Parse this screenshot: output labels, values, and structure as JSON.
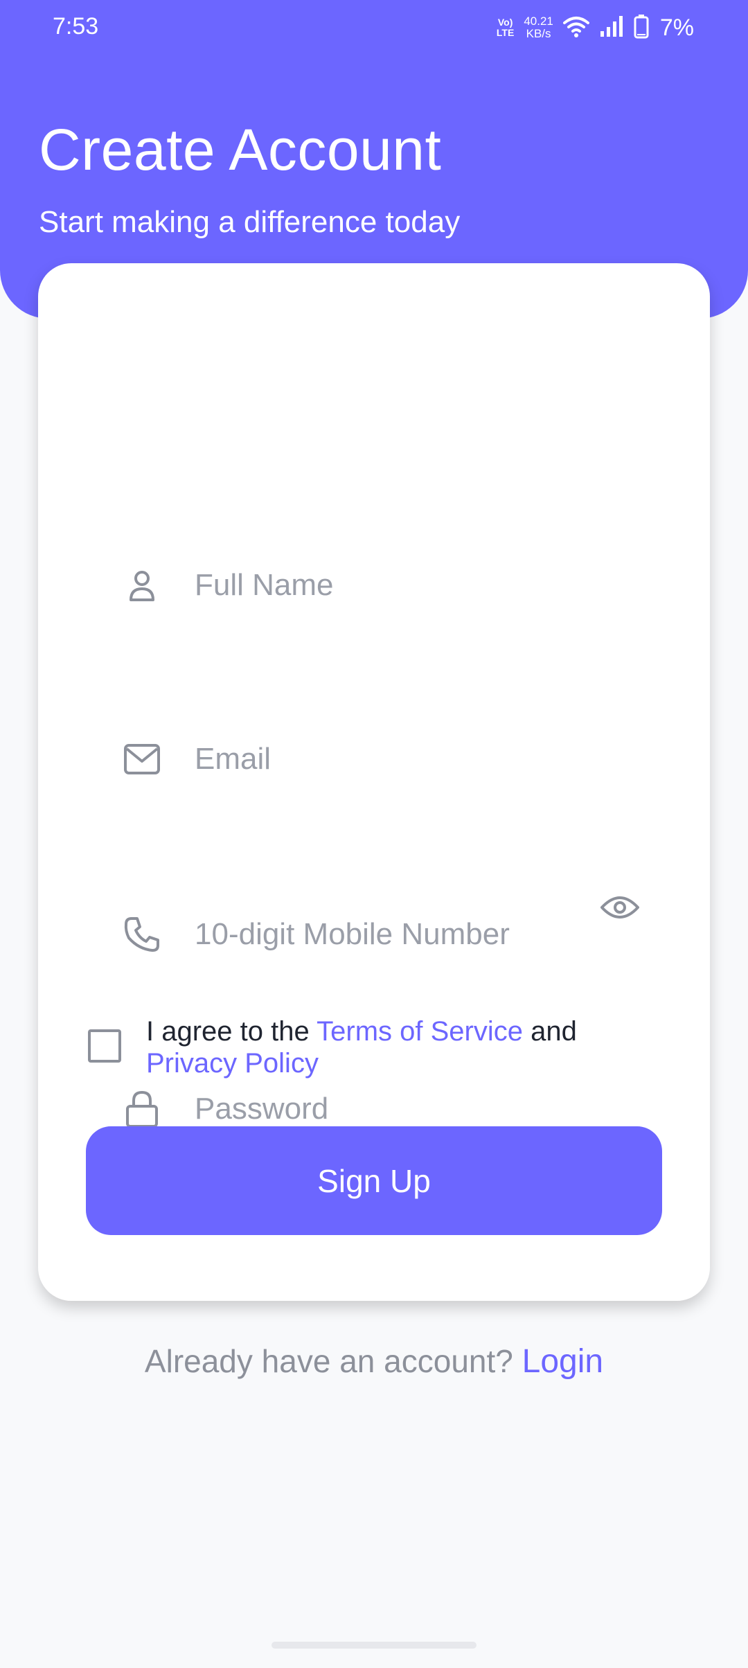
{
  "status_bar": {
    "time": "7:53",
    "volte_top": "Vo)",
    "volte_bottom": "LTE",
    "net_speed_value": "40.21",
    "net_speed_unit": "KB/s",
    "battery_percent": "7%",
    "icons": [
      "wifi-icon",
      "signal-icon",
      "battery-icon"
    ]
  },
  "header": {
    "title": "Create Account",
    "subtitle": "Start making a difference today"
  },
  "form": {
    "full_name": {
      "placeholder": "Full Name",
      "value": "",
      "icon": "person-icon"
    },
    "email": {
      "placeholder": "Email",
      "value": "",
      "icon": "mail-icon"
    },
    "mobile": {
      "placeholder": "10-digit Mobile Number",
      "value": "",
      "icon": "phone-icon"
    },
    "password": {
      "placeholder": "Password",
      "value": "",
      "icon": "lock-icon",
      "toggle_icon": "eye-icon"
    }
  },
  "agreement": {
    "checked": false,
    "prefix": "I agree to the ",
    "terms_link": "Terms of Service",
    "middle": " and",
    "privacy_link": "Privacy Policy"
  },
  "signup_button": "Sign Up",
  "footer": {
    "prompt": "Already have an account? ",
    "login_link": "Login"
  },
  "colors": {
    "accent": "#6c66ff",
    "background": "#f8f9fb",
    "card": "#ffffff",
    "placeholder": "#9a9ea8"
  }
}
